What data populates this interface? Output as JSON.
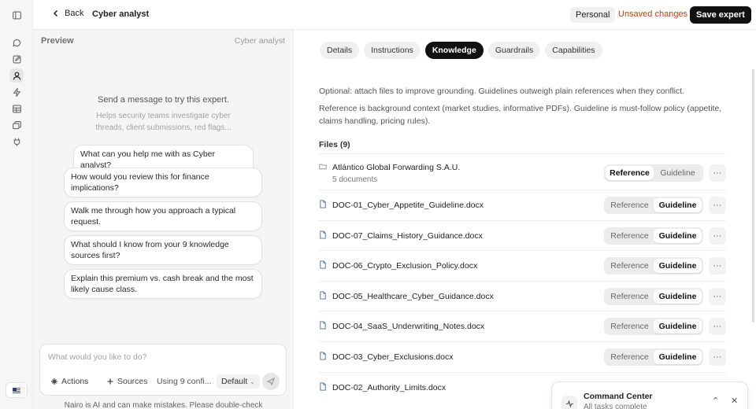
{
  "topbar": {
    "back_label": "Back",
    "expert_name": "Cyber analyst",
    "workspace": "Personal",
    "unsaved": "Unsaved changes",
    "save_label": "Save expert"
  },
  "rail": {
    "items": [
      "sidebar-toggle-icon",
      "chat-icon",
      "edit-icon",
      "user-icon",
      "bolt-icon",
      "grid-icon",
      "layers-icon",
      "plug-icon"
    ],
    "flag": "US"
  },
  "preview": {
    "title": "Preview",
    "expert_name": "Cyber analyst",
    "try_message": "Send a message to try this expert.",
    "helps_text": "Helps security teams investigate cyber threads, client submissions, red flags...",
    "suggestions": [
      "What can you help me with as Cyber analyst?",
      "How would you review this for finance implications?",
      "Walk me through how you approach a typical request.",
      "What should I know from your 9 knowledge sources first?",
      "Explain this premium vs. cash break and the most likely cause class."
    ],
    "composer": {
      "placeholder": "What would you like to do?",
      "actions_label": "Actions",
      "sources_label": "Sources",
      "using_label": "Using 9 confi...",
      "model_label": "Default"
    },
    "disclaimer": "Nairo is AI and can make mistakes. Please double-check"
  },
  "main": {
    "tabs": [
      "Details",
      "Instructions",
      "Knowledge",
      "Guardrails",
      "Capabilities"
    ],
    "active_tab": "Knowledge",
    "note1": "Optional: attach files to improve grounding. Guidelines outweigh plain references when they conflict.",
    "note2": "Reference is background context (market studies, informative PDFs). Guideline is must-follow policy (appetite, claims handling, pricing rules).",
    "files_heading": "Files (9)",
    "seg_reference": "Reference",
    "seg_guideline": "Guideline",
    "more_label": "···",
    "files": [
      {
        "name": "Atlántico Global Forwarding S.A.U.",
        "sub": "5 documents",
        "type": "folder",
        "mode": "Reference"
      },
      {
        "name": "DOC-01_Cyber_Appetite_Guideline.docx",
        "type": "doc",
        "mode": "Guideline"
      },
      {
        "name": "DOC-07_Claims_History_Guidance.docx",
        "type": "doc",
        "mode": "Guideline"
      },
      {
        "name": "DOC-06_Crypto_Exclusion_Policy.docx",
        "type": "doc",
        "mode": "Guideline"
      },
      {
        "name": "DOC-05_Healthcare_Cyber_Guidance.docx",
        "type": "doc",
        "mode": "Guideline"
      },
      {
        "name": "DOC-04_SaaS_Underwriting_Notes.docx",
        "type": "doc",
        "mode": "Guideline"
      },
      {
        "name": "DOC-03_Cyber_Exclusions.docx",
        "type": "doc",
        "mode": "Guideline"
      },
      {
        "name": "DOC-02_Authority_Limits.docx",
        "type": "doc",
        "mode": "Guideline"
      }
    ]
  },
  "command_center": {
    "title": "Command Center",
    "status": "All tasks complete"
  },
  "colors": {
    "accent_dark": "#111111",
    "unsaved": "#c2410c",
    "doc_icon": "#4a6fa5"
  }
}
